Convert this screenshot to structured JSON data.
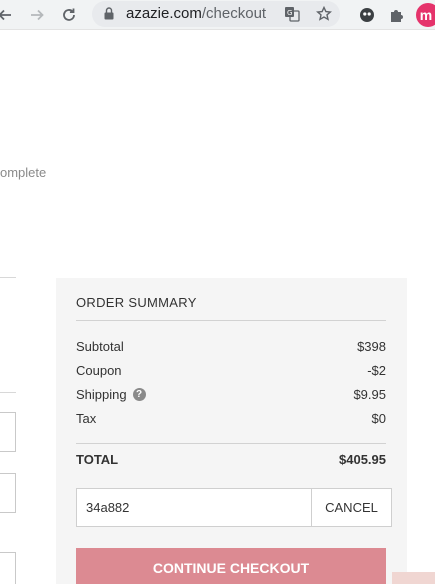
{
  "browser": {
    "url_host": "azazie.com",
    "url_path": "/checkout",
    "profile_initial": "m"
  },
  "page": {
    "step_label": "omplete"
  },
  "order_summary": {
    "title": "ORDER SUMMARY",
    "rows": [
      {
        "label": "Subtotal",
        "value": "$398"
      },
      {
        "label": "Coupon",
        "value": "-$2"
      },
      {
        "label": "Shipping",
        "value": "$9.95"
      },
      {
        "label": "Tax",
        "value": "$0"
      }
    ],
    "total_label": "TOTAL",
    "total_value": "$405.95",
    "coupon_code": "34a882",
    "cancel_label": "CANCEL",
    "checkout_label": "CONTINUE CHECKOUT",
    "checkout_color": "#dc8a92"
  }
}
